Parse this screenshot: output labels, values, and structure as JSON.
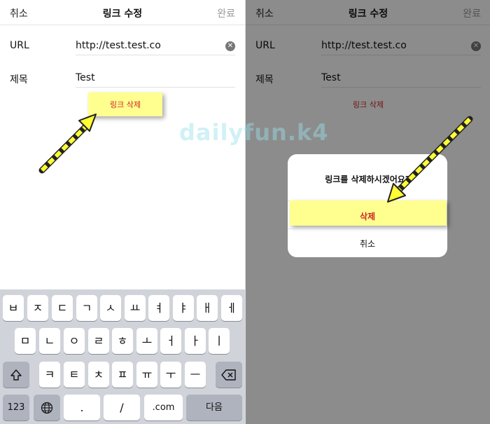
{
  "left_screen": {
    "nav": {
      "cancel": "취소",
      "title": "링크 수정",
      "done": "완료"
    },
    "form": {
      "url_label": "URL",
      "url_value": "http://test.test.co",
      "title_label": "제목",
      "title_value": "Test"
    },
    "delete_link": "링크 삭제"
  },
  "keyboard": {
    "row1": [
      "ㅂ",
      "ㅈ",
      "ㄷ",
      "ㄱ",
      "ㅅ",
      "ㅛ",
      "ㅕ",
      "ㅑ",
      "ㅐ",
      "ㅔ"
    ],
    "row2": [
      "ㅁ",
      "ㄴ",
      "ㅇ",
      "ㄹ",
      "ㅎ",
      "ㅗ",
      "ㅓ",
      "ㅏ",
      "ㅣ"
    ],
    "row3": [
      "ㅋ",
      "ㅌ",
      "ㅊ",
      "ㅍ",
      "ㅠ",
      "ㅜ",
      "ㅡ"
    ],
    "shift_icon": "shift-icon",
    "backspace_icon": "backspace-icon",
    "numbers": "123",
    "globe_icon": "globe-icon",
    "dot": ".",
    "slash": "/",
    "dotcom": ".com",
    "next": "다음"
  },
  "right_screen": {
    "nav": {
      "cancel": "취소",
      "title": "링크 수정",
      "done": "완료"
    },
    "form": {
      "url_label": "URL",
      "url_value": "http://test.test.co",
      "title_label": "제목",
      "title_value": "Test"
    },
    "delete_link": "링크 삭제",
    "dialog": {
      "message": "링크를 삭제하시겠어요?",
      "delete": "삭제",
      "cancel": "취소"
    }
  },
  "watermark": "dailyfun.k4",
  "colors": {
    "highlight": "#ffff8f",
    "destructive": "#d02424",
    "arrow": "#ffff33"
  }
}
